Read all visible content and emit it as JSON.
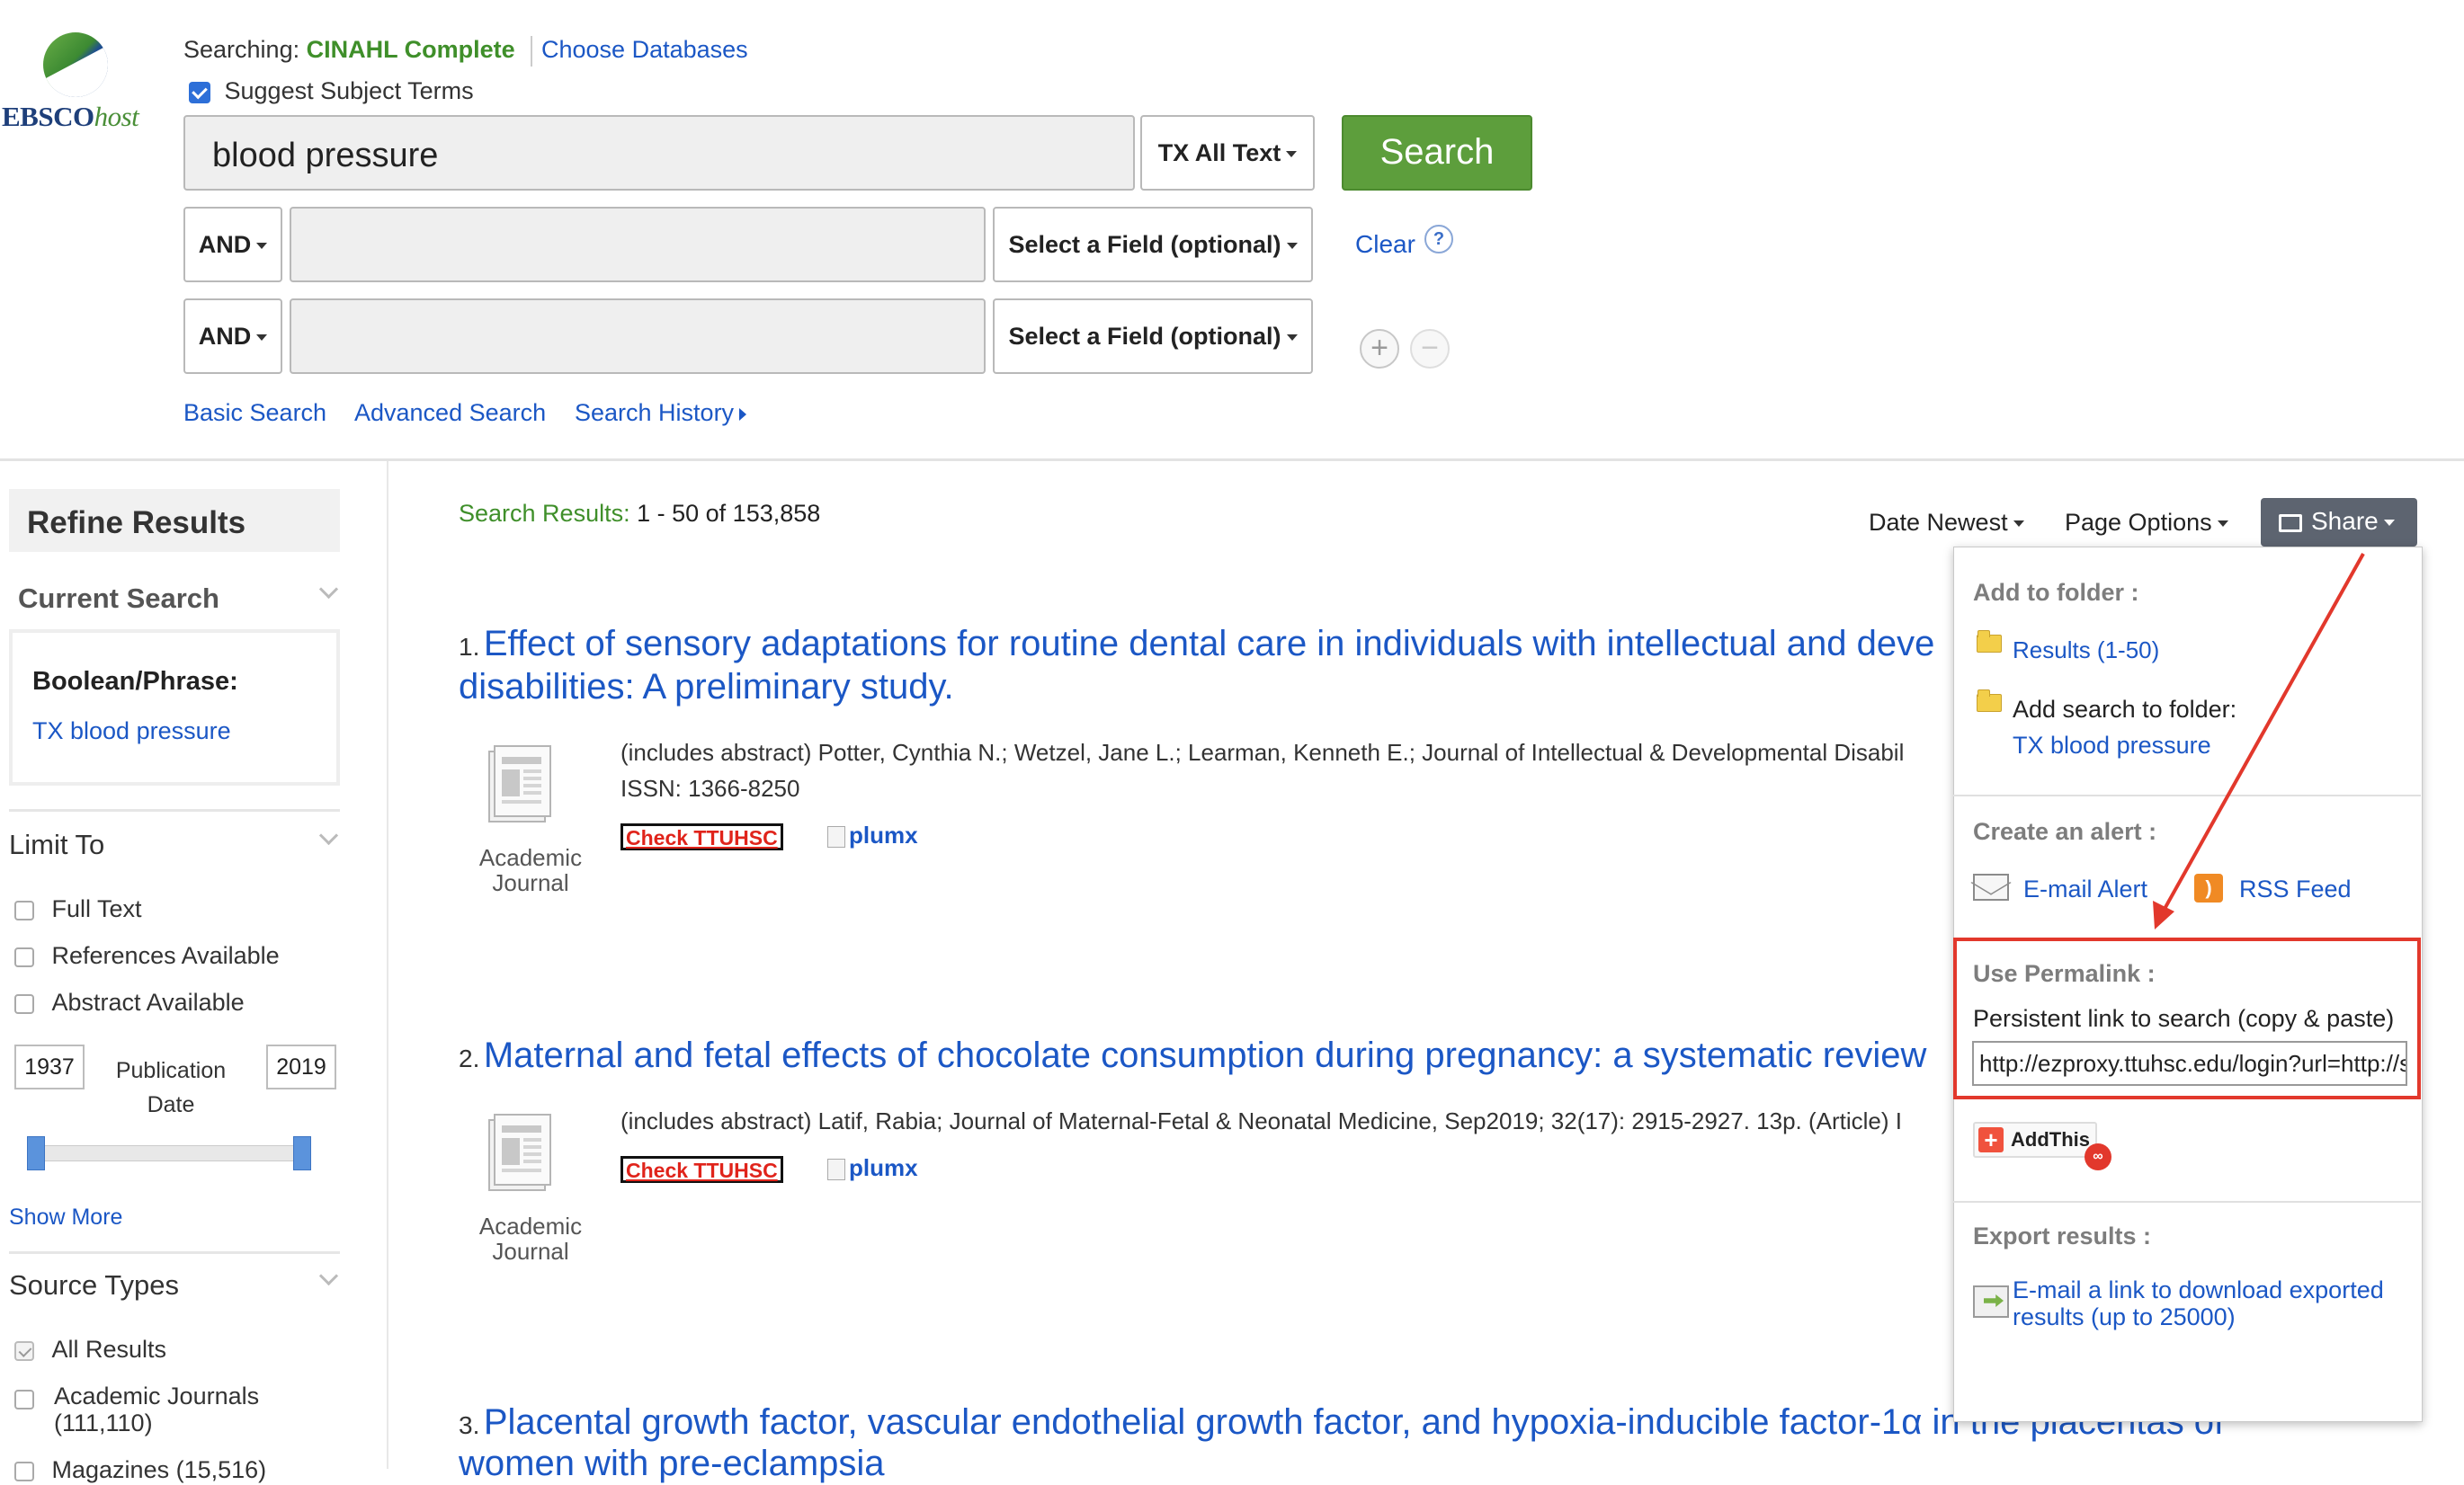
{
  "brand": {
    "logo_text_bold": "EBSCO",
    "logo_text_italic": "host"
  },
  "header": {
    "searching_label": "Searching:",
    "database": "CINAHL Complete",
    "choose_databases": "Choose Databases",
    "suggest_subject_terms": "Suggest Subject Terms",
    "suggest_checked": true
  },
  "search": {
    "rows": [
      {
        "operator": "",
        "value": "blood pressure",
        "field": "TX All Text"
      },
      {
        "operator": "AND",
        "value": "",
        "field": "Select a Field (optional)"
      },
      {
        "operator": "AND",
        "value": "",
        "field": "Select a Field (optional)"
      }
    ],
    "search_button": "Search",
    "clear_label": "Clear",
    "help_glyph": "?",
    "add_row_glyph": "+",
    "remove_row_glyph": "−"
  },
  "nav": {
    "basic": "Basic Search",
    "advanced": "Advanced Search",
    "history": "Search History"
  },
  "sidebar": {
    "refine_title": "Refine Results",
    "current_search_title": "Current Search",
    "boolean_label": "Boolean/Phrase:",
    "boolean_value": "TX blood pressure",
    "limit_to_title": "Limit To",
    "limits": [
      "Full Text",
      "References Available",
      "Abstract Available"
    ],
    "pub_date": {
      "from": "1937",
      "to": "2019",
      "label_line1": "Publication",
      "label_line2": "Date"
    },
    "show_more": "Show More",
    "source_types_title": "Source Types",
    "source_types": [
      {
        "label": "All Results",
        "count": ""
      },
      {
        "label": "Academic Journals",
        "count": "(111,110)"
      },
      {
        "label": "Magazines (15,516)",
        "count": ""
      }
    ]
  },
  "results_header": {
    "label": "Search Results:",
    "range": "1 - 50 of 153,858",
    "sort": "Date Newest",
    "page_options": "Page Options",
    "share": "Share"
  },
  "results": [
    {
      "num": "1.",
      "title_line1": "Effect of sensory adaptations for routine dental care in individuals with intellectual and deve",
      "title_line2": "disabilities: A preliminary study.",
      "meta_line1": "(includes abstract) Potter, Cynthia N.; Wetzel, Jane L.; Learman, Kenneth E.; Journal of Intellectual & Developmental Disabil",
      "meta_line2": "ISSN: 1366-8250",
      "type_line1": "Academic",
      "type_line2": "Journal",
      "check": "Check TTUHSC",
      "plumx": "plumx"
    },
    {
      "num": "2.",
      "title_line1": "Maternal and fetal effects of chocolate consumption during pregnancy: a systematic review",
      "title_line2": "",
      "meta_line1": "(includes abstract) Latif, Rabia; Journal of Maternal-Fetal & Neonatal Medicine, Sep2019; 32(17): 2915-2927. 13p. (Article) I",
      "meta_line2": "",
      "type_line1": "Academic",
      "type_line2": "Journal",
      "check": "Check TTUHSC",
      "plumx": "plumx"
    },
    {
      "num": "3.",
      "title_line1": "Placental growth factor, vascular endothelial growth factor, and hypoxia-inducible factor-1α in the placentas of",
      "title_line2": "women with pre-eclampsia"
    }
  ],
  "share_menu": {
    "folder_title": "Add to folder :",
    "results_folder": "Results (1-50)",
    "add_search_folder": "Add search to folder:",
    "search_folder_value": "TX blood pressure",
    "alert_title": "Create an alert :",
    "email_alert": "E-mail Alert",
    "rss_feed": "RSS Feed",
    "permalink_title": "Use Permalink :",
    "permalink_desc": "Persistent link to search (copy & paste)",
    "permalink_value": "http://ezproxy.ttuhsc.edu/login?url=http://search.ebscohost.com/login.aspx?direct=true&db=rzh&bquery=blood+pressure",
    "addthis": "AddThis",
    "export_title": "Export results :",
    "export_link_line1": "E-mail a link to download exported",
    "export_link_line2": "results (up to 25000)"
  },
  "colors": {
    "accent_link": "#1b57c5",
    "search_green": "#5d9e3c",
    "highlight_red": "#e2382c"
  }
}
